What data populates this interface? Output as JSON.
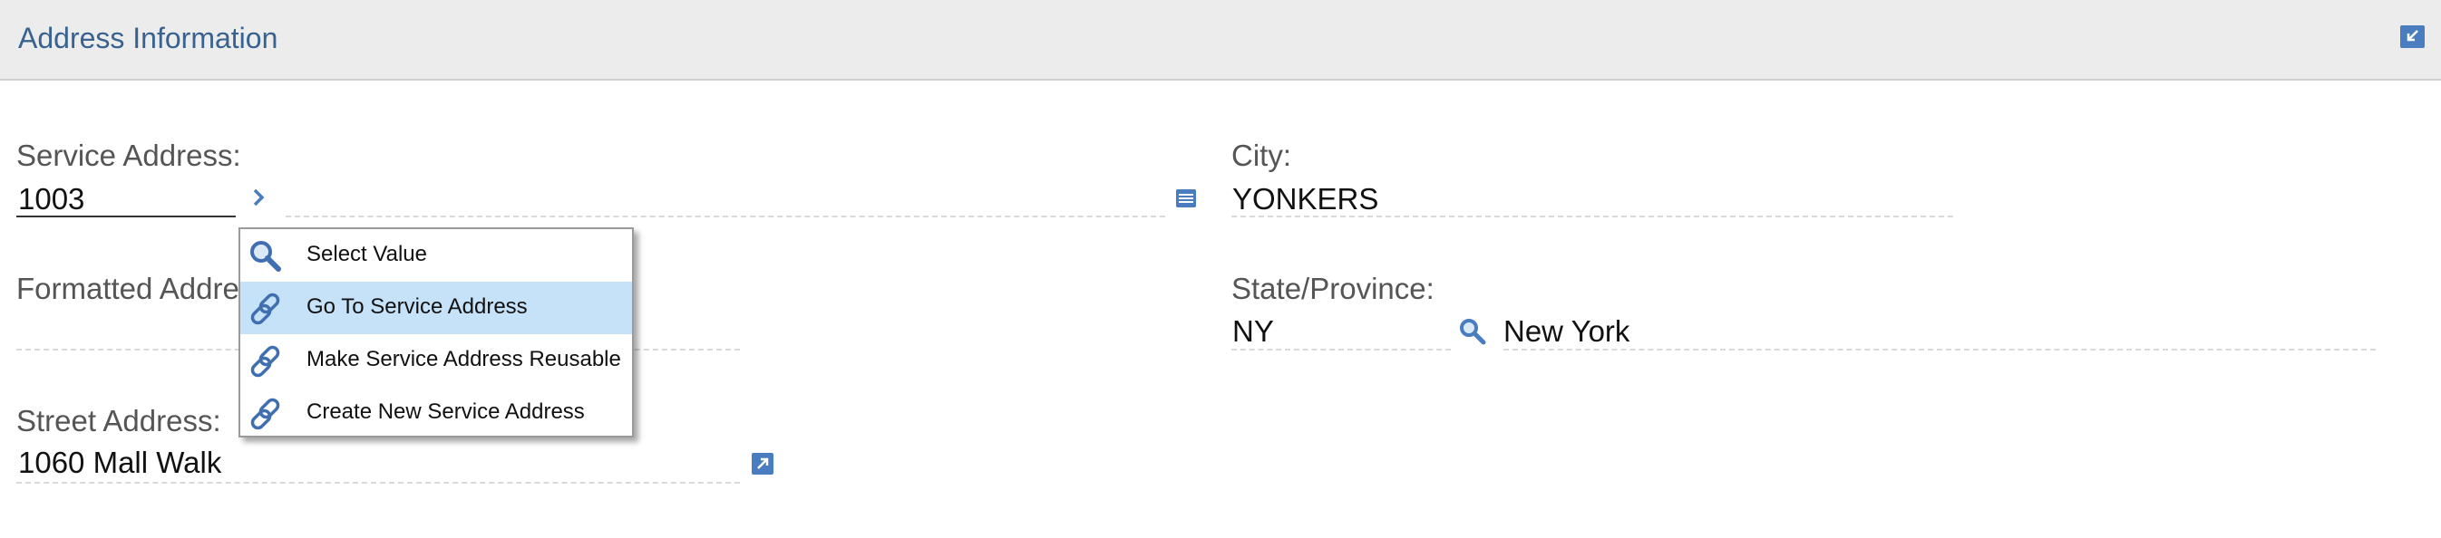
{
  "section": {
    "title": "Address Information",
    "collapse_icon": "collapse-arrow-icon"
  },
  "fields": {
    "service_address": {
      "label": "Service Address:",
      "value": "1003"
    },
    "formatted_address": {
      "label": "Formatted Address:",
      "value": ""
    },
    "street_address": {
      "label": "Street Address:",
      "value": "1060 Mall Walk"
    },
    "city": {
      "label": "City:",
      "value": "YONKERS"
    },
    "state": {
      "label": "State/Province:",
      "code": "NY",
      "name": "New York"
    }
  },
  "menu": {
    "items": [
      {
        "label": "Select Value",
        "icon": "search-icon"
      },
      {
        "label": "Go To Service Address",
        "icon": "link-icon",
        "highlighted": true
      },
      {
        "label": "Make Service Address Reusable",
        "icon": "link-icon"
      },
      {
        "label": "Create New Service Address",
        "icon": "link-icon"
      }
    ]
  },
  "colors": {
    "accent": "#4a7cc0",
    "title": "#38628f",
    "menu_highlight": "#c6e2f8",
    "header_bg": "#ececec"
  }
}
